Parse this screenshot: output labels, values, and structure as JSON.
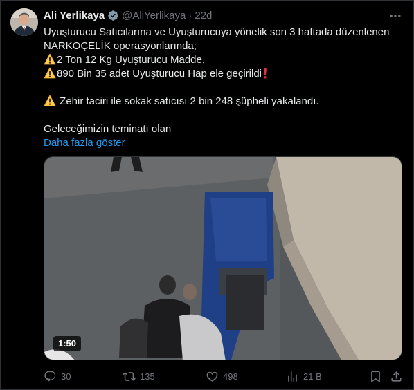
{
  "user": {
    "name": "Ali Yerlikaya",
    "handle": "@AliYerlikaya",
    "separator": "·",
    "time": "22d"
  },
  "tweet": {
    "line1": "Uyuşturucu Satıcılarına ve Uyuşturucuya yönelik son 3 haftada düzenlenen",
    "line2": "NARKOÇELİK operasyonlarında;",
    "line3": "2 Ton 12 Kg Uyuşturucu Madde,",
    "line4": "890 Bin 35 adet Uyuşturucu Hap ele geçirildi",
    "line5": "Zehir taciri ile sokak satıcısı 2 bin 248 şüpheli yakalandı.",
    "line6": "Geleceğimizin teminatı olan",
    "show_more": "Daha fazla göster"
  },
  "media": {
    "duration": "1:50"
  },
  "actions": {
    "replies": "30",
    "reposts": "135",
    "likes": "498",
    "views": "21 B"
  },
  "colors": {
    "background": "#000000",
    "text": "#e7e9ea",
    "muted": "#71767b",
    "link": "#1d9bf0",
    "verified": "#829aab"
  },
  "icons": {
    "verified": "verified-badge-icon",
    "more": "more-options-icon",
    "warning": "warning-emoji-icon",
    "exclamation": "red-exclamation-emoji-icon",
    "reply": "reply-icon",
    "repost": "repost-icon",
    "like": "heart-icon",
    "views": "views-chart-icon",
    "bookmark": "bookmark-icon",
    "share": "share-icon"
  }
}
